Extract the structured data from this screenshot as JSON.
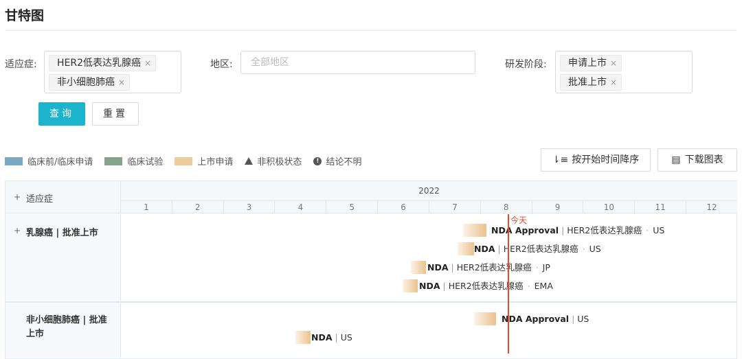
{
  "page": {
    "title": "甘特图"
  },
  "filters": {
    "indication_label": "适应症:",
    "indication_tags": [
      "HER2低表达乳腺癌",
      "非小细胞肺癌"
    ],
    "region_label": "地区:",
    "region_placeholder": "全部地区",
    "stage_label": "研发阶段:",
    "stage_tags": [
      "申请上市",
      "批准上市"
    ],
    "remove_glyph": "×"
  },
  "buttons": {
    "query": "查询",
    "reset": "重置",
    "sort": "按开始时间降序",
    "download": "下载图表"
  },
  "legend": [
    {
      "label": "临床前/临床申请",
      "color": "#7aa9c4"
    },
    {
      "label": "临床试验",
      "color": "#86a48c"
    },
    {
      "label": "上市申请",
      "color": "#eecb9a"
    },
    {
      "label": "非积极状态",
      "icon": "triangle-icon"
    },
    {
      "label": "结论不明",
      "icon": "exclamation-icon"
    }
  ],
  "gantt": {
    "header_label": "适应症",
    "expand_glyph": "+",
    "year": "2022",
    "months": [
      "1",
      "2",
      "3",
      "4",
      "5",
      "6",
      "7",
      "8",
      "9",
      "10",
      "11",
      "12"
    ],
    "today_label": "今天",
    "groups": [
      {
        "label": "乳腺癌 | 批准上市",
        "rows": [
          {
            "type": "NDA Approval",
            "indication": "HER2低表达乳腺癌",
            "region": "US"
          },
          {
            "type": "NDA",
            "indication": "HER2低表达乳腺癌",
            "region": "US"
          },
          {
            "type": "NDA",
            "indication": "HER2低表达乳腺癌",
            "region": "JP"
          },
          {
            "type": "NDA",
            "indication": "HER2低表达乳腺癌",
            "region": "EMA"
          }
        ]
      },
      {
        "label": "非小细胞肺癌 | 批准上市",
        "rows": [
          {
            "type": "NDA Approval",
            "region": "US"
          },
          {
            "type": "NDA",
            "region": "US"
          }
        ]
      }
    ]
  }
}
